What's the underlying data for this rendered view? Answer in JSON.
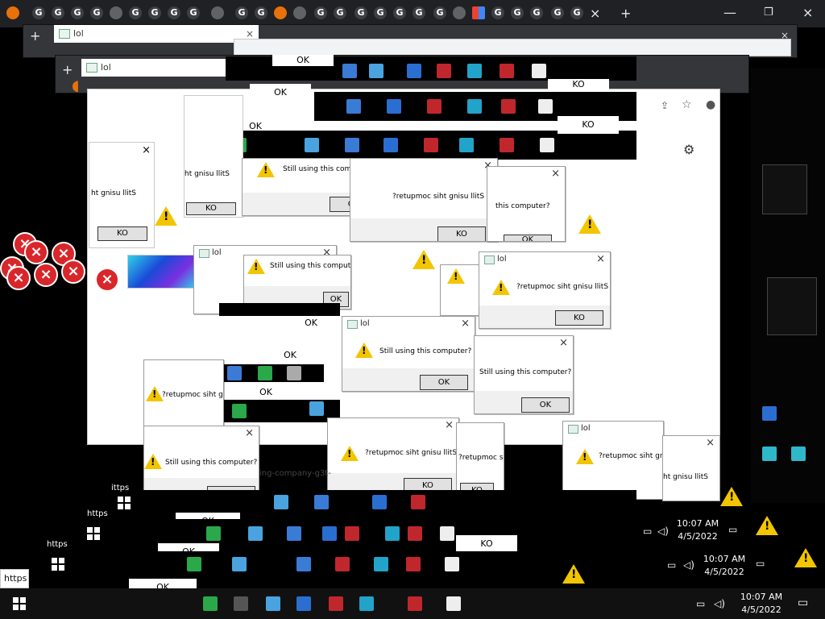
{
  "browser": {
    "tab_title": "lol",
    "new_tab_symbol": "+",
    "close_symbol": "×",
    "minimize_symbol": "—",
    "maximize_symbol": "❐",
    "url_fragment": "https",
    "url_fragment_2": "ittps",
    "addressbar_fragment": "ing-company-g3t-"
  },
  "dialog": {
    "title": "lol",
    "message": "Still using this computer?",
    "message_mirrored": "?retupmoc siht gnisu llitS",
    "message_partial_1": "Still using this comput",
    "message_partial_2": "?retupmoc siht gnisu llit",
    "message_partial_3": "?retupmoc siht gnisu",
    "message_partial_4": "ht gnisu llitS",
    "message_partial_5": "this computer?",
    "message_partial_6": "ing this computer",
    "ok_label": "OK",
    "ok_label_mirrored": "KO"
  },
  "taskbar": {
    "time": "10:07 AM",
    "date": "4/5/2022",
    "time_cut": "10:07 AM"
  },
  "colors": {
    "warning": "#f2c500",
    "error": "#d9262b",
    "chrome_dark": "#202124",
    "dialog_footer": "#f0f0f0"
  },
  "icons": [
    "chrome-icon",
    "globe-icon",
    "google-g-icon",
    "microsoft-icon",
    "warning-icon",
    "error-icon",
    "close-icon",
    "plus-icon",
    "windows-start-icon",
    "volume-icon",
    "network-icon",
    "notification-icon",
    "settings-icon",
    "star-icon",
    "share-icon",
    "profile-icon"
  ]
}
